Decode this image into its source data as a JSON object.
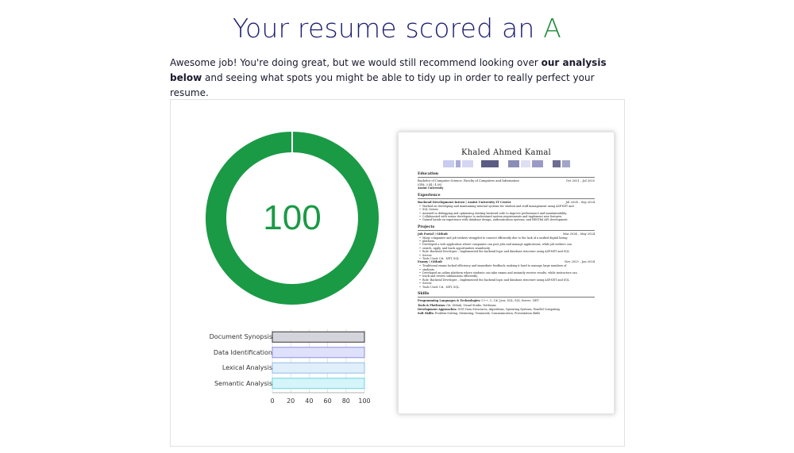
{
  "headline": {
    "text": "Your resume scored an ",
    "grade": "A"
  },
  "intro": {
    "before": "Awesome job! You're doing great, but we would still recommend looking over ",
    "bold": "our analysis below",
    "after": " and seeing what spots you might be able to tidy up in order to really perfect your resume."
  },
  "score": {
    "value": "100",
    "fraction": 1.0,
    "color": "#1a9a45"
  },
  "chart_data": {
    "type": "bar",
    "orientation": "horizontal",
    "categories": [
      "Document Synopsis",
      "Data Identification",
      "Lexical Analysis",
      "Semantic Analysis"
    ],
    "values": [
      100,
      100,
      100,
      100
    ],
    "colors": [
      "#d4d4dc",
      "#dfe1fb",
      "#e0effb",
      "#d4f5fa"
    ],
    "borders": [
      "#333333",
      "#8a8fe0",
      "#8fbde8",
      "#6fd4e0"
    ],
    "xticks": [
      "0",
      "20",
      "40",
      "60",
      "80",
      "100"
    ],
    "xlim": [
      0,
      100
    ]
  },
  "resume": {
    "name": "Khaled Ahmed Kamal",
    "contact_blocks": [
      {
        "w": 14,
        "c": "#c9cbf0"
      },
      {
        "w": 6,
        "c": "#a9abd8"
      },
      {
        "w": 14,
        "c": "#d5d6f2"
      },
      {
        "w": 6,
        "c": "#ffffff"
      },
      {
        "w": 22,
        "c": "#5b5c82"
      },
      {
        "w": 8,
        "c": "#ffffff"
      },
      {
        "w": 14,
        "c": "#8c8db5"
      },
      {
        "w": 12,
        "c": "#dedff3"
      },
      {
        "w": 14,
        "c": "#9a9bc5"
      },
      {
        "w": 8,
        "c": "#ffffff"
      },
      {
        "w": 10,
        "c": "#6c6d90"
      },
      {
        "w": 10,
        "c": "#a3a4c8"
      }
    ],
    "sections": {
      "education": "Education",
      "experience": "Experience",
      "projects": "Projects",
      "skills": "Skills"
    },
    "education": {
      "degree": "Bachelor of Computer Science, Faculty of Computers and Information",
      "dates": "Oct 2021 – Jul 2025",
      "gpa": "(GPA: 3.44 / 4.00)",
      "school": "Assiut University"
    },
    "experience": {
      "title": "Backend Development Intern | Assiut University IT Center",
      "dates": "Jul 2024 – Sep 2024",
      "bullets": [
        "Worked on developing and maintaining internal systems for student and staff management using ASP.NET and",
        "SQL Server.",
        "Assisted in debugging and optimizing existing backend code to improve performance and maintainability.",
        "Collaborated with senior developers to understand system requirements and implement new features.",
        "Gained hands-on experience with database design, authentication systems, and RESTful API development."
      ]
    },
    "projects": [
      {
        "title": "Job Portal | Github",
        "dates": "Mar 2024 – May 2024",
        "bullets": [
          "Many companies and job-seekers struggled to connect efficiently due to the lack of a unified digital hiring",
          "platform.",
          "Developed a web application where companies can post jobs and manage applications, while job-seekers can",
          "search, apply, and track opportunities seamlessly.",
          "Role: Backend Developer – Implemented the backend logic and database structure using ASP.NET and SQL",
          "Server.",
          "Tools Used: C#, .NET, SQL"
        ]
      },
      {
        "title": "Examy | Github",
        "dates": "Nov 2023 – Jan 2024",
        "bullets": [
          "Traditional exams lacked efficiency and immediate feedback, making it hard to manage large numbers of",
          "students.",
          "Developed an online platform where students can take exams and instantly receive results, while instructors can",
          "track and review submissions efficiently.",
          "Role: Backend Developer – Implemented the backend logic and database structure using ASP.NET and SQL",
          "Server.",
          "Tools Used: C#, .NET, SQL"
        ]
      }
    ],
    "skills": [
      {
        "label": "Programming Languages & Technologies:",
        "value": " C++, C, C#, Java, SQL, SQL Server, .NET"
      },
      {
        "label": "Tools & Platforms:",
        "value": " Git, Github, Visual Studio, Netbeans"
      },
      {
        "label": "Development Approaches:",
        "value": " OOP, Data Structures, Algorithms, Operating Systems, Parallel Computing"
      },
      {
        "label": "Soft Skills:",
        "value": " Problem-Solving, Mentoring, Teamwork, Communication, Presentation Skills"
      }
    ]
  }
}
